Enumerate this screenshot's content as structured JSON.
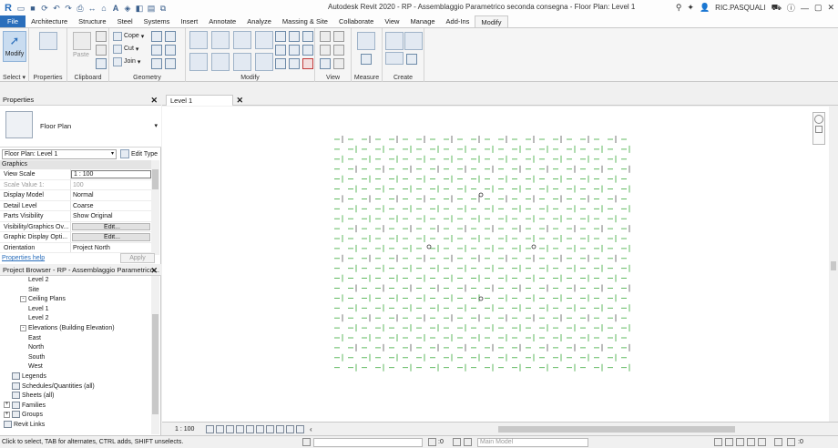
{
  "window": {
    "title": "Autodesk Revit 2020 - RP - Assemblaggio Parametrico seconda consegna - Floor Plan: Level 1",
    "user": "RIC.PASQUALI"
  },
  "ribbon_tabs": [
    "File",
    "Architecture",
    "Structure",
    "Steel",
    "Systems",
    "Insert",
    "Annotate",
    "Analyze",
    "Massing & Site",
    "Collaborate",
    "View",
    "Manage",
    "Add-Ins",
    "Modify"
  ],
  "active_tab": "Modify",
  "ribbon": {
    "modify_label": "Modify",
    "paste_label": "Paste",
    "cope_label": "Cope",
    "cut_label": "Cut",
    "join_label": "Join",
    "groups": {
      "select": "Select",
      "properties": "Properties",
      "clipboard": "Clipboard",
      "geometry": "Geometry",
      "modify": "Modify",
      "view": "View",
      "measure": "Measure",
      "create": "Create"
    }
  },
  "properties": {
    "title": "Properties",
    "type_name": "Floor Plan",
    "instance_selector": "Floor Plan: Level 1",
    "edit_type": "Edit Type",
    "category": "Graphics",
    "rows": [
      {
        "key": "View Scale",
        "value": "1 : 100"
      },
      {
        "key": "Scale Value    1:",
        "value": "100"
      },
      {
        "key": "Display Model",
        "value": "Normal"
      },
      {
        "key": "Detail Level",
        "value": "Coarse"
      },
      {
        "key": "Parts Visibility",
        "value": "Show Original"
      },
      {
        "key": "Visibility/Graphics Ov...",
        "value": "Edit..."
      },
      {
        "key": "Graphic Display Opti...",
        "value": "Edit..."
      },
      {
        "key": "Orientation",
        "value": "Project North"
      }
    ],
    "help_link": "Properties help",
    "apply": "Apply"
  },
  "project_browser": {
    "title": "Project Browser - RP - Assemblaggio Parametrico...",
    "nodes": [
      {
        "label": "Level 2",
        "level": 3
      },
      {
        "label": "Site",
        "level": 3
      },
      {
        "label": "Ceiling Plans",
        "level": 2,
        "toggle": "-"
      },
      {
        "label": "Level 1",
        "level": 3
      },
      {
        "label": "Level 2",
        "level": 3
      },
      {
        "label": "Elevations (Building Elevation)",
        "level": 2,
        "toggle": "-"
      },
      {
        "label": "East",
        "level": 3
      },
      {
        "label": "North",
        "level": 3
      },
      {
        "label": "South",
        "level": 3
      },
      {
        "label": "West",
        "level": 3
      },
      {
        "label": "Legends",
        "level": 1,
        "icon": true
      },
      {
        "label": "Schedules/Quantities (all)",
        "level": 1,
        "icon": true
      },
      {
        "label": "Sheets (all)",
        "level": 1,
        "icon": true
      },
      {
        "label": "Families",
        "level": 0,
        "toggle": "+",
        "icon": true
      },
      {
        "label": "Groups",
        "level": 0,
        "toggle": "+",
        "icon": true
      },
      {
        "label": "Revit Links",
        "level": 0,
        "icon": true
      }
    ]
  },
  "view": {
    "tab_label": "Level 1",
    "scale": "1 : 100"
  },
  "status": {
    "message": "Click to select, TAB for alternates, CTRL adds, SHIFT unselects.",
    "zero": ":0",
    "model": "Main Model",
    "filter": ":0"
  },
  "colors": {
    "accent": "#2a6ebb",
    "plan_lines": "#3aa83a"
  }
}
